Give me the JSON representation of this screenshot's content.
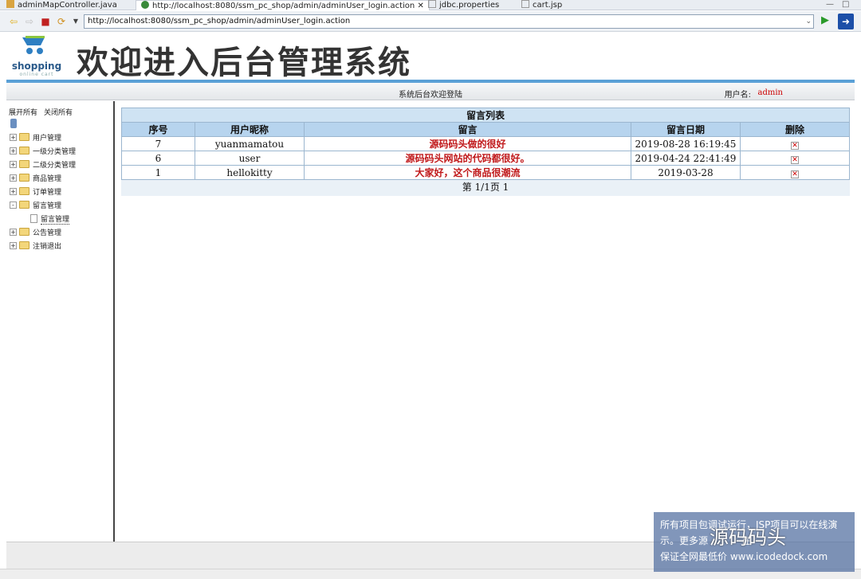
{
  "ide_tabs": [
    {
      "label": "adminMapController.java",
      "active": false
    },
    {
      "label": "http://localhost:8080/ssm_pc_shop/admin/adminUser_login.action",
      "active": true,
      "close": "✕"
    },
    {
      "label": "jdbc.properties",
      "active": false
    },
    {
      "label": "cart.jsp",
      "active": false
    }
  ],
  "browser": {
    "url": "http://localhost:8080/ssm_pc_shop/admin/adminUser_login.action"
  },
  "banner": {
    "logo_text": "shopping",
    "logo_sub": "online cart",
    "title": "欢迎进入后台管理系统"
  },
  "status": {
    "welcome": "系统后台欢迎登陆",
    "user_label": "用户名:",
    "user_name": "admin"
  },
  "sidebar": {
    "expand_all": "展开所有",
    "collapse_all": "关闭所有",
    "nodes": [
      {
        "label": "用户管理",
        "state": "+"
      },
      {
        "label": "一级分类管理",
        "state": "+"
      },
      {
        "label": "二级分类管理",
        "state": "+"
      },
      {
        "label": "商品管理",
        "state": "+"
      },
      {
        "label": "订单管理",
        "state": "+"
      },
      {
        "label": "留言管理",
        "state": "-"
      },
      {
        "label": "公告管理",
        "state": "+"
      },
      {
        "label": "注销退出",
        "state": "+"
      }
    ],
    "open_leaf": "留言管理"
  },
  "table": {
    "caption": "留言列表",
    "headers": [
      "序号",
      "用户昵称",
      "留言",
      "留言日期",
      "删除"
    ],
    "rows": [
      {
        "id": "7",
        "nick": "yuanmamatou",
        "message": "源码码头做的很好",
        "date": "2019-08-28 16:19:45"
      },
      {
        "id": "6",
        "nick": "user",
        "message": "源码码头网站的代码都很好。",
        "date": "2019-04-24 22:41:49"
      },
      {
        "id": "1",
        "nick": "hellokitty",
        "message": "大家好，这个商品很潮流",
        "date": "2019-03-28"
      }
    ],
    "pager": "第 1/1页 1"
  },
  "watermark": {
    "line1": "所有项目包调试运行，JSP项目可以在线演",
    "line2": "示。更多源",
    "line2b": "在",
    "big": "源码码头",
    "line3": "保证全网最低价 www.icodedock.com"
  }
}
